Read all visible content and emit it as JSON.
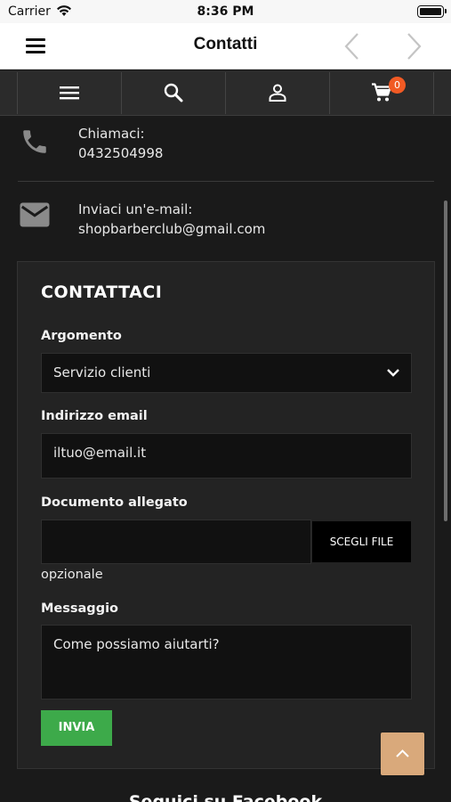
{
  "status_bar": {
    "carrier": "Carrier",
    "time": "8:36 PM"
  },
  "nav": {
    "title": "Contatti"
  },
  "toolbar": {
    "icons": [
      "menu-icon",
      "search-icon",
      "account-icon",
      "cart-icon"
    ],
    "cart_count": "0",
    "badge_color": "#f15a24"
  },
  "contacts": {
    "phone_label": "Chiamaci:",
    "phone_value": "0432504998",
    "email_label": "Inviaci un'e-mail:",
    "email_value": "shopbarberclub@gmail.com"
  },
  "form": {
    "title": "CONTATTACI",
    "subject_label": "Argomento",
    "subject_value": "Servizio clienti",
    "email_label": "Indirizzo email",
    "email_placeholder": "iltuo@email.it",
    "attachment_label": "Documento allegato",
    "file_button": "SCEGLI FILE",
    "optional": "opzionale",
    "message_label": "Messaggio",
    "message_placeholder": "Come possiamo aiutarti?",
    "send_button": "INVIA",
    "send_color": "#3daa4a"
  },
  "footer": {
    "follow_heading": "Seguici su Facebook"
  },
  "scroll_top_color": "#d9a97b"
}
